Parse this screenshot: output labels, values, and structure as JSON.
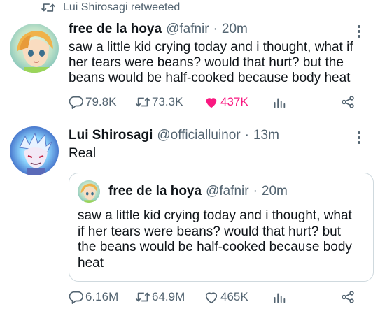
{
  "retweet_banner": {
    "text": "Lui Shirosagi retweeted",
    "icon": "retweet-icon"
  },
  "tweet1": {
    "name": "free de la hoya",
    "handle": "@fafnir",
    "dot": "·",
    "time": "20m",
    "text": "saw a little kid crying today and i thought, what if her tears were beans? would that hurt? but the beans would be half-cooked because body heat",
    "actions": {
      "replies": "79.8K",
      "retweets": "73.3K",
      "likes": "437K"
    },
    "liked": true
  },
  "tweet2": {
    "name": "Lui Shirosagi",
    "handle": "@officialluinor",
    "dot": "·",
    "time": "13m",
    "text": "Real",
    "quote": {
      "name": "free de la hoya",
      "handle": "@fafnir",
      "dot": "·",
      "time": "20m",
      "text": "saw a little kid crying today and i thought, what if her tears were beans? would that hurt? but the beans would be half-cooked because body heat"
    },
    "actions": {
      "replies": "6.16M",
      "retweets": "64.9M",
      "likes": "465K"
    },
    "liked": false
  },
  "colors": {
    "secondary": "#536471",
    "like": "#f91880",
    "border": "#cfd9de"
  }
}
